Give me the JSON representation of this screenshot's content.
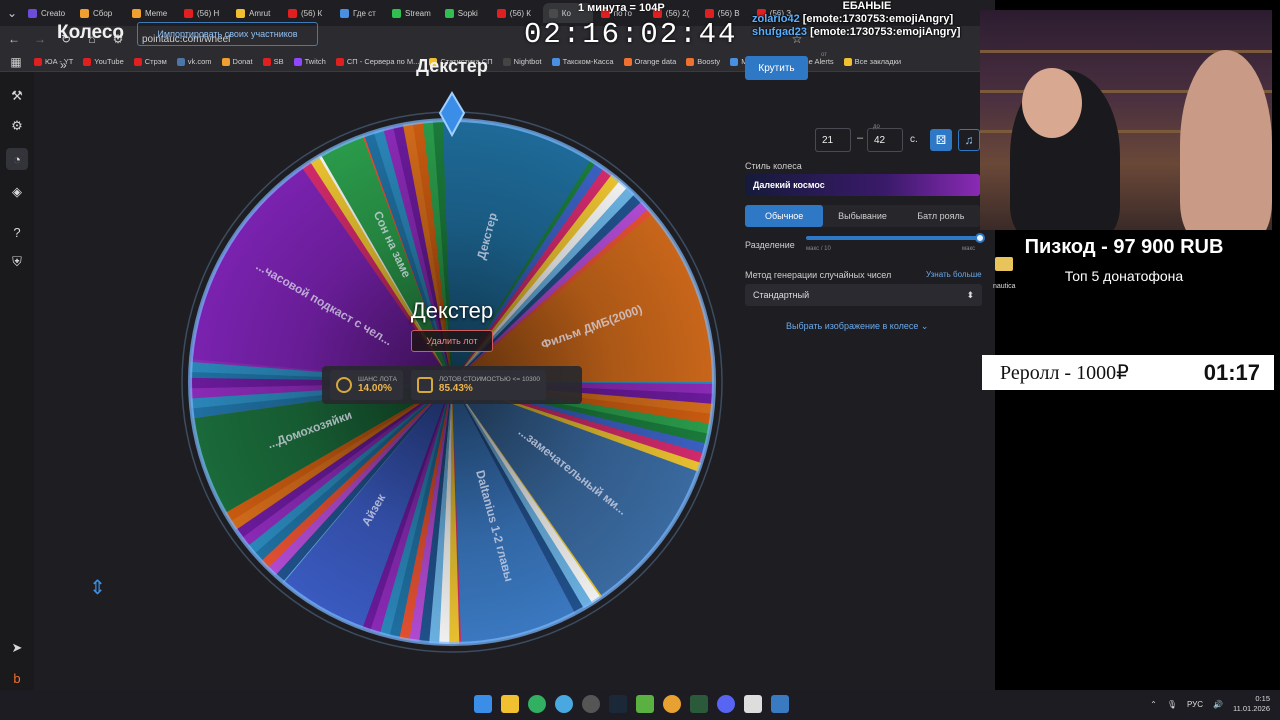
{
  "browser": {
    "tabs": [
      {
        "label": "Creato",
        "color": "#6c4cd8"
      },
      {
        "label": "Сбор",
        "color": "#f0a030"
      },
      {
        "label": "Meme",
        "color": "#f0a030"
      },
      {
        "label": "(56) Н",
        "color": "#e02020"
      },
      {
        "label": "Amrut",
        "color": "#f0c030"
      },
      {
        "label": "(56) К",
        "color": "#e02020"
      },
      {
        "label": "Где ст",
        "color": "#4a90e2"
      },
      {
        "label": "Stream",
        "color": "#30c050"
      },
      {
        "label": "Sopki",
        "color": "#30c050"
      },
      {
        "label": "(56) К",
        "color": "#e02020"
      },
      {
        "label": "Ко",
        "color": "#4a4a4a"
      },
      {
        "label": "по го",
        "color": "#e02020"
      },
      {
        "label": "(56) 2(",
        "color": "#e02020"
      },
      {
        "label": "(56) В",
        "color": "#e02020"
      },
      {
        "label": "(56) З",
        "color": "#e02020"
      }
    ],
    "url": "pointauc.com/wheel",
    "bookmarks": [
      {
        "label": "ЮA - YT",
        "color": "#e02020"
      },
      {
        "label": "YouTube",
        "color": "#e02020"
      },
      {
        "label": "Стрэм",
        "color": "#e02020"
      },
      {
        "label": "vk.com",
        "color": "#4a76a8"
      },
      {
        "label": "Donat",
        "color": "#f0a030"
      },
      {
        "label": "SB",
        "color": "#e02020"
      },
      {
        "label": "Twitch",
        "color": "#9146ff"
      },
      {
        "label": "СП - Сервера по М...",
        "color": "#e02020"
      },
      {
        "label": "Статистика СП",
        "color": "#f0c030"
      },
      {
        "label": "Nightbot",
        "color": "#444"
      },
      {
        "label": "Такском-Касса",
        "color": "#4a90e2"
      },
      {
        "label": "Orange data",
        "color": "#f07030"
      },
      {
        "label": "Boosty",
        "color": "#f07030"
      },
      {
        "label": "Мой ГАЗ",
        "color": "#4a90e2"
      },
      {
        "label": "Meme Alerts",
        "color": "#f0c030"
      },
      {
        "label": "Все закладки",
        "color": "#f0c030"
      }
    ]
  },
  "app": {
    "title": "Колесо",
    "import_button": "Импортировать своих участников",
    "expand_icon": "»",
    "wheel": {
      "winner_top": "Декстер",
      "center_name": "Декстер",
      "delete_button": "Удалить лот",
      "chance_label": "ШАНС ЛОТА",
      "chance_value": "14.00%",
      "cheaper_label": "ЛОТОВ СТОИМОСТЬЮ <= 10300",
      "cheaper_value": "85.43%",
      "labels": [
        "Декстер",
        "Фильм ДМБ(2000)",
        "...замечательный ми...",
        "Daltanius 1-2 главы",
        "Айзек",
        "...Домохозяйки",
        "...часовой подкаст с чел...",
        "Сон на заме"
      ]
    },
    "controls": {
      "spin_button": "Крутить",
      "from_caption": "от",
      "from_value": "21",
      "to_caption": "до",
      "to_value": "42",
      "seconds": "с.",
      "style_label": "Стиль колеса",
      "style_value": "Далекий космос",
      "modes": [
        "Обычное",
        "Выбывание",
        "Батл рояль"
      ],
      "split_label": "Разделение",
      "split_min": "макс / 10",
      "split_max": "макс",
      "split_level": 1.0,
      "rng_label": "Метод генерации случайных чисел",
      "rng_link": "Узнать больше",
      "rng_value": "Стандартный",
      "image_link": "Выбрать изображение в колесе"
    }
  },
  "overlay": {
    "top_note": "1 минута = 104Р",
    "timer": "02:16:02:44",
    "chat": [
      {
        "user": "",
        "text": "ЕБАНЫЕ"
      },
      {
        "user": "zolario42",
        "text": "[emote:1730753:emojiAngry]"
      },
      {
        "user": "shufgad23",
        "text": "[emote:1730753:emojiAngry]"
      }
    ],
    "donation_title": "Пизкод - 97 900 RUB",
    "donation_sub": "Топ  5 донатофона",
    "reroll_label": "Реролл - 1000₽",
    "reroll_timer": "01:17",
    "folder_label": "nautica"
  },
  "taskbar": {
    "language": "РУС",
    "time": "0:15",
    "date": "11.01.2026"
  }
}
